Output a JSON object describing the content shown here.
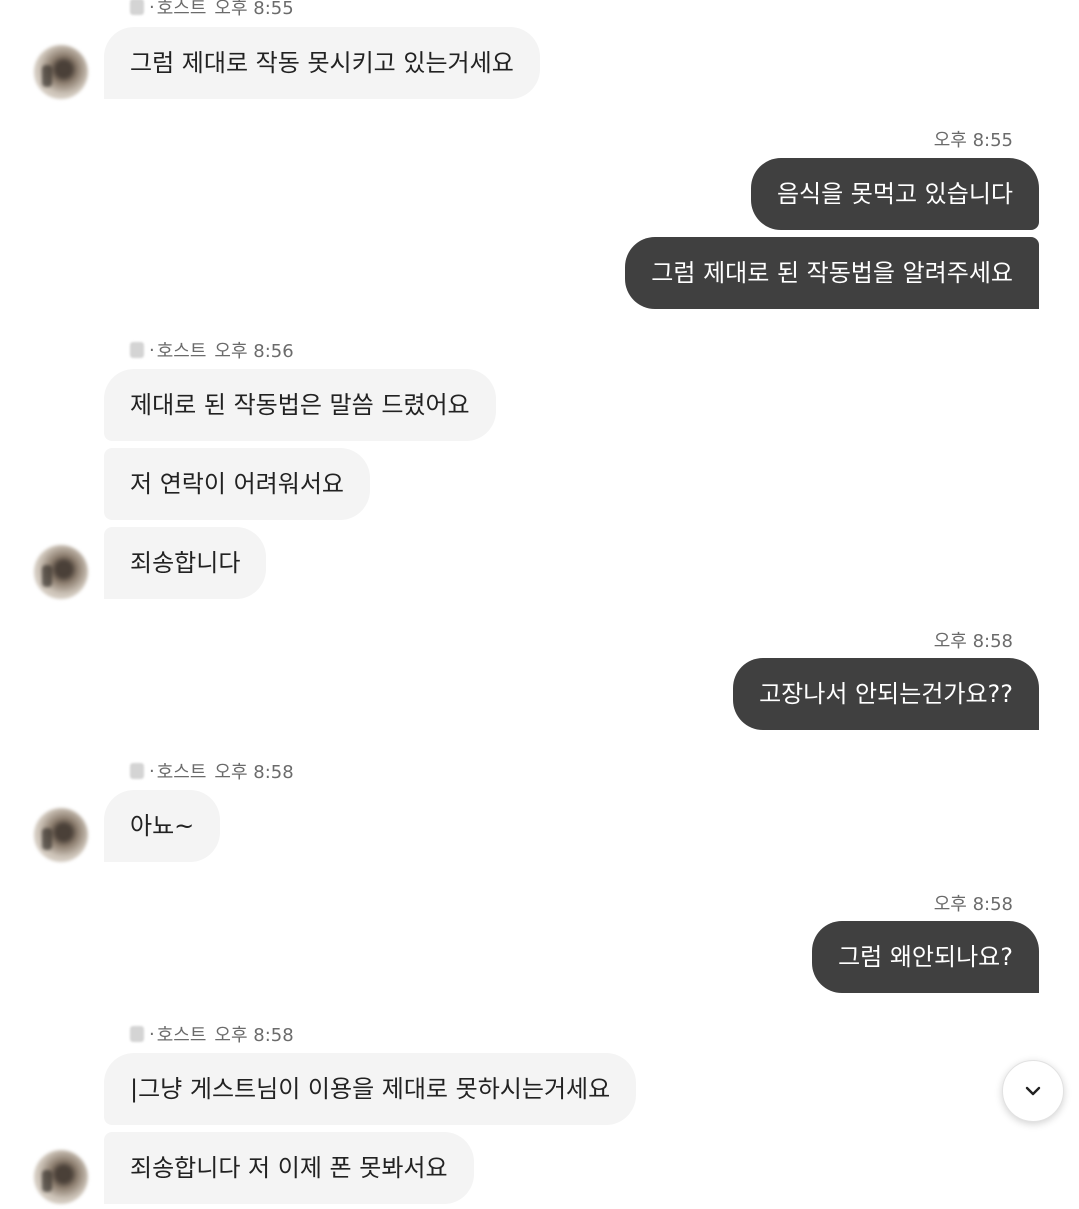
{
  "host_label": "호스트",
  "messages": [
    {
      "text": "그럼 제대로 작동 못시키고 있는거세요"
    },
    {
      "time": "오후 8:55",
      "text": "음식을 못먹고 있습니다"
    },
    {
      "text": "그럼 제대로 된 작동법을 알려주세요"
    },
    {
      "time": "오후 8:56",
      "text": "제대로 된 작동법은 말씀 드렸어요"
    },
    {
      "text": "저 연락이 어려워서요"
    },
    {
      "text": "죄송합니다"
    },
    {
      "time": "오후 8:58",
      "text": "고장나서 안되는건가요??"
    },
    {
      "time": "오후 8:58",
      "text": "아뇨~"
    },
    {
      "time": "오후 8:58",
      "text": "그럼 왜안되나요?"
    },
    {
      "time": "오후 8:58",
      "text": "|그냥 게스트님이 이용을 제대로 못하시는거세요"
    },
    {
      "text": "죄송합니다 저 이제 폰 못봐서요"
    }
  ],
  "top_meta_time": "오후 8:55",
  "icons": {
    "scroll_down": "chevron-down-icon"
  },
  "colors": {
    "outgoing_bubble": "#404040",
    "incoming_bubble": "#f4f4f4"
  }
}
